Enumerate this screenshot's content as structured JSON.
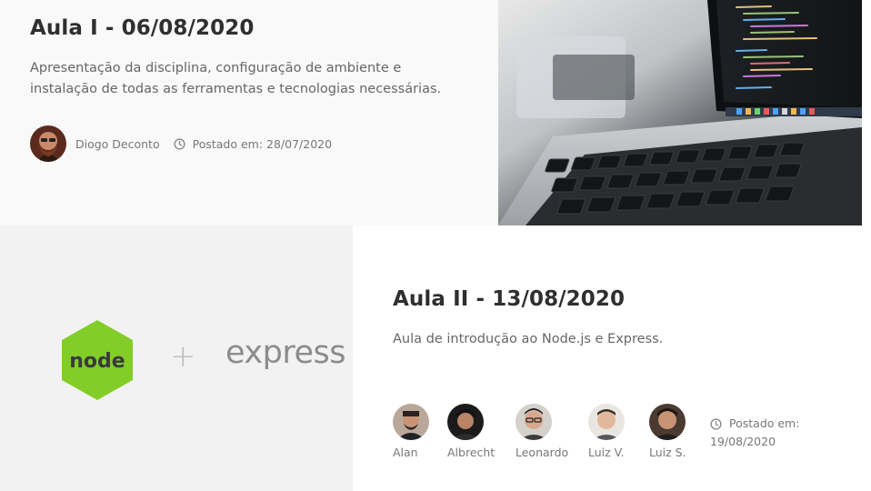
{
  "posts": [
    {
      "title": "Aula I - 06/08/2020",
      "description_lines": [
        "Apresentação da disciplina, configuração de ambiente e",
        "instalação de todas as ferramentas e tecnologias necessárias."
      ],
      "author": "Diogo Deconto",
      "posted": "Postado em: 28/07/2020",
      "image": "laptop-code-photo"
    },
    {
      "title": "Aula II - 13/08/2020",
      "description": "Aula de introdução ao Node.js e Express.",
      "authors": [
        "Alan",
        "Albrecht",
        "Leonardo",
        "Luiz V.",
        "Luiz S."
      ],
      "posted_label": "Postado em:",
      "posted_date": "19/08/2020",
      "image": {
        "node_logo_text": "node",
        "plus": "+",
        "express_text": "express"
      }
    }
  ],
  "icons": {
    "clock": "clock-icon"
  },
  "colors": {
    "node_green": "#83cd29",
    "title": "#2f2f2f",
    "meta": "#777777"
  }
}
